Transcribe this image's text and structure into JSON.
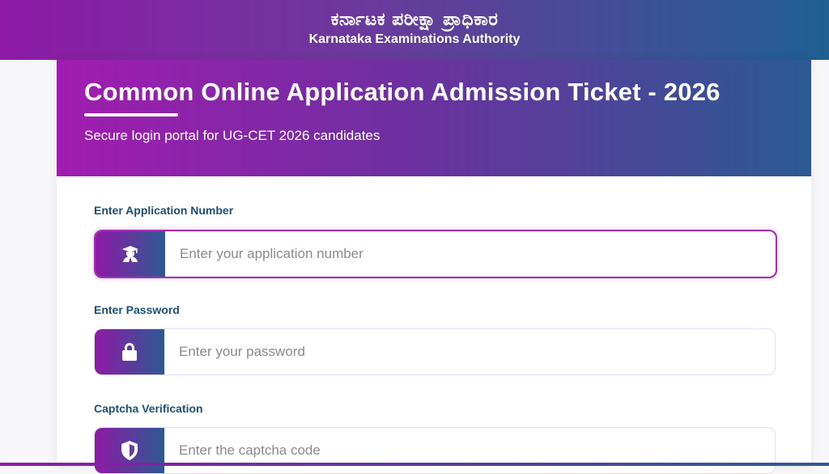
{
  "header": {
    "title_kn": "ಕರ್ನಾಟಕ ಪರೀಕ್ಷಾ ಪ್ರಾಧಿಕಾರ",
    "title_en": "Karnataka Examinations Authority"
  },
  "hero": {
    "title": "Common Online Application Admission Ticket - 2026",
    "subtitle": "Secure login portal for UG-CET 2026 candidates"
  },
  "form": {
    "application": {
      "label": "Enter Application Number",
      "placeholder": "Enter your application number",
      "icon": "graduate-icon"
    },
    "password": {
      "label": "Enter Password",
      "placeholder": "Enter your password",
      "icon": "lock-icon"
    },
    "captcha": {
      "label": "Captcha Verification",
      "placeholder": "Enter the captcha code",
      "icon": "shield-icon"
    }
  },
  "colors": {
    "accent_purple": "#a11cb0",
    "accent_blue": "#1f5f92",
    "label_color": "#1b4f7a"
  }
}
